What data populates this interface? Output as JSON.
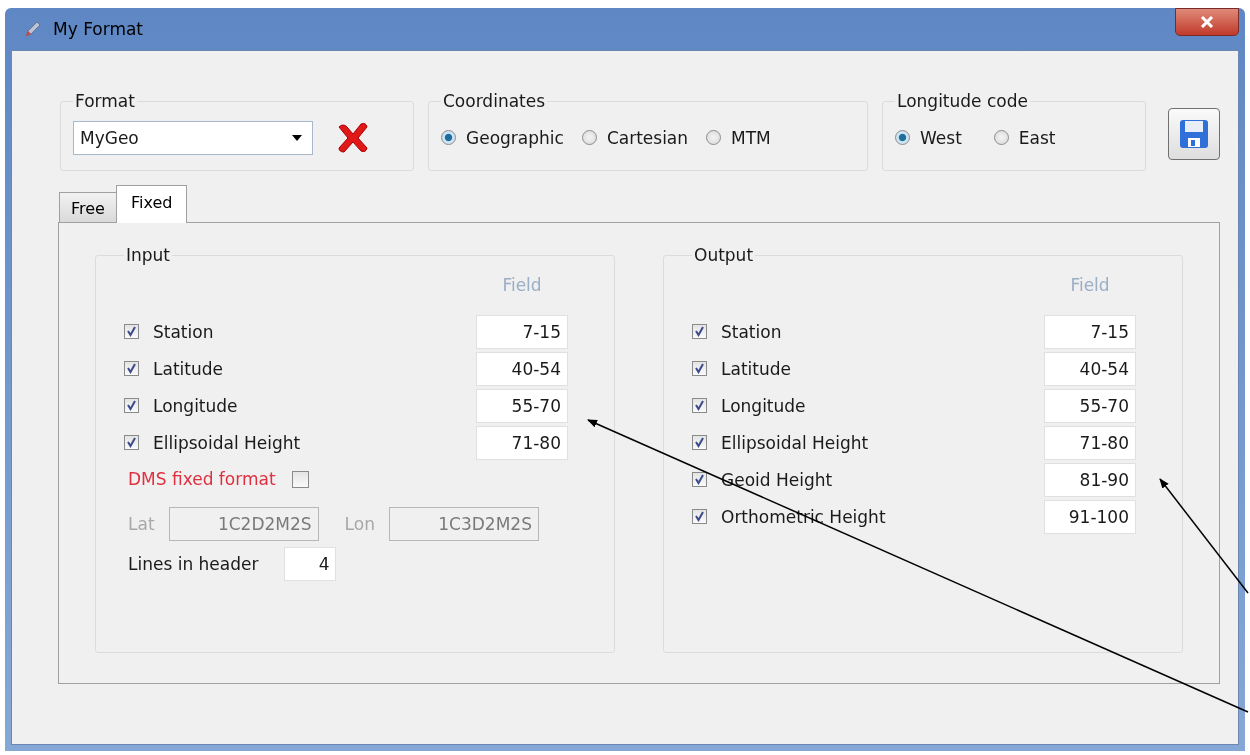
{
  "window": {
    "title": "My Format"
  },
  "format": {
    "label": "Format",
    "value": "MyGeo"
  },
  "coordinates": {
    "label": "Coordinates",
    "options": [
      {
        "label": "Geographic",
        "selected": true
      },
      {
        "label": "Cartesian",
        "selected": false
      },
      {
        "label": "MTM",
        "selected": false
      }
    ]
  },
  "longitude_code": {
    "label": "Longitude code",
    "options": [
      {
        "label": "West",
        "selected": true
      },
      {
        "label": "East",
        "selected": false
      }
    ]
  },
  "tabs": [
    {
      "label": "Free",
      "selected": false
    },
    {
      "label": "Fixed",
      "selected": true
    }
  ],
  "input": {
    "label": "Input",
    "field_header": "Field",
    "rows": [
      {
        "label": "Station",
        "checked": true,
        "field": "7-15"
      },
      {
        "label": "Latitude",
        "checked": true,
        "field": "40-54"
      },
      {
        "label": "Longitude",
        "checked": true,
        "field": "55-70"
      },
      {
        "label": "Ellipsoidal Height",
        "checked": true,
        "field": "71-80"
      }
    ],
    "dms": {
      "label": "DMS fixed format",
      "checked": false
    },
    "lat": {
      "label": "Lat",
      "value": "1C2D2M2S"
    },
    "lon": {
      "label": "Lon",
      "value": "1C3D2M2S"
    },
    "lines_in_header": {
      "label": "Lines in header",
      "value": "4"
    }
  },
  "output": {
    "label": "Output",
    "field_header": "Field",
    "rows": [
      {
        "label": "Station",
        "checked": true,
        "field": "7-15"
      },
      {
        "label": "Latitude",
        "checked": true,
        "field": "40-54"
      },
      {
        "label": "Longitude",
        "checked": true,
        "field": "55-70"
      },
      {
        "label": "Ellipsoidal Height",
        "checked": true,
        "field": "71-80"
      },
      {
        "label": "Geoid Height",
        "checked": true,
        "field": "81-90"
      },
      {
        "label": "Orthometric Height",
        "checked": true,
        "field": "91-100"
      }
    ]
  }
}
